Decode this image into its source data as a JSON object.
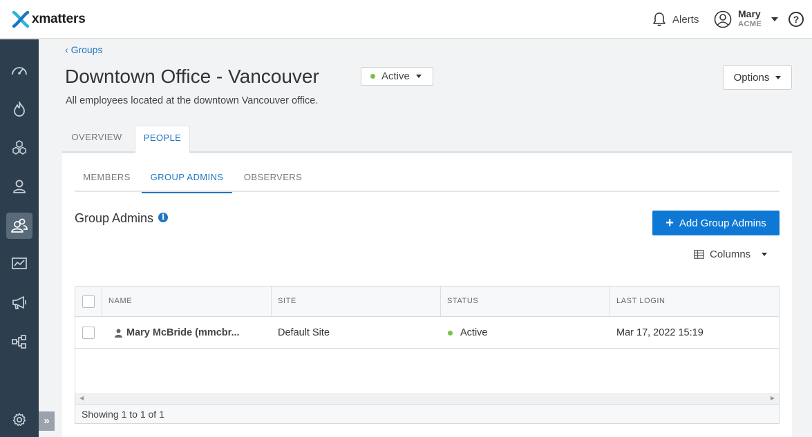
{
  "app": {
    "logo_text": "xmatters"
  },
  "header": {
    "alerts_label": "Alerts",
    "user_name": "Mary",
    "user_org": "ACME",
    "help_label": "?"
  },
  "sidebar": {
    "items": [
      {
        "name": "dashboard",
        "icon": "speedometer-icon",
        "active": false
      },
      {
        "name": "incidents",
        "icon": "flame-icon",
        "active": false
      },
      {
        "name": "services",
        "icon": "hexagons-icon",
        "active": false
      },
      {
        "name": "users",
        "icon": "user-icon",
        "active": false
      },
      {
        "name": "groups",
        "icon": "users-icon",
        "active": true
      },
      {
        "name": "reports",
        "icon": "chart-icon",
        "active": false
      },
      {
        "name": "messaging",
        "icon": "megaphone-icon",
        "active": false
      },
      {
        "name": "workflows",
        "icon": "flow-icon",
        "active": false
      },
      {
        "name": "settings",
        "icon": "gear-icon",
        "active": false
      }
    ],
    "expand_label": "»"
  },
  "breadcrumb": {
    "label": "Groups"
  },
  "page": {
    "title": "Downtown Office - Vancouver",
    "status": "Active",
    "options_label": "Options",
    "description": "All employees located at the downtown Vancouver office."
  },
  "tabs": [
    {
      "label": "OVERVIEW",
      "active": false
    },
    {
      "label": "PEOPLE",
      "active": true
    }
  ],
  "subtabs": [
    {
      "label": "MEMBERS",
      "active": false
    },
    {
      "label": "GROUP ADMINS",
      "active": true
    },
    {
      "label": "OBSERVERS",
      "active": false
    }
  ],
  "section": {
    "title": "Group Admins",
    "info_glyph": "i",
    "add_button_label": "Add Group Admins",
    "columns_label": "Columns"
  },
  "table": {
    "headers": [
      "NAME",
      "SITE",
      "STATUS",
      "LAST LOGIN"
    ],
    "rows": [
      {
        "name": "Mary McBride (mmcbr...",
        "site": "Default Site",
        "status": "Active",
        "last_login": "Mar 17, 2022 15:19"
      }
    ],
    "footer": "Showing 1 to 1 of 1"
  },
  "colors": {
    "accent": "#1f76c2",
    "primary_button": "#0f78d4",
    "sidebar_bg": "#2d3f4f",
    "status_active": "#7ac143"
  }
}
